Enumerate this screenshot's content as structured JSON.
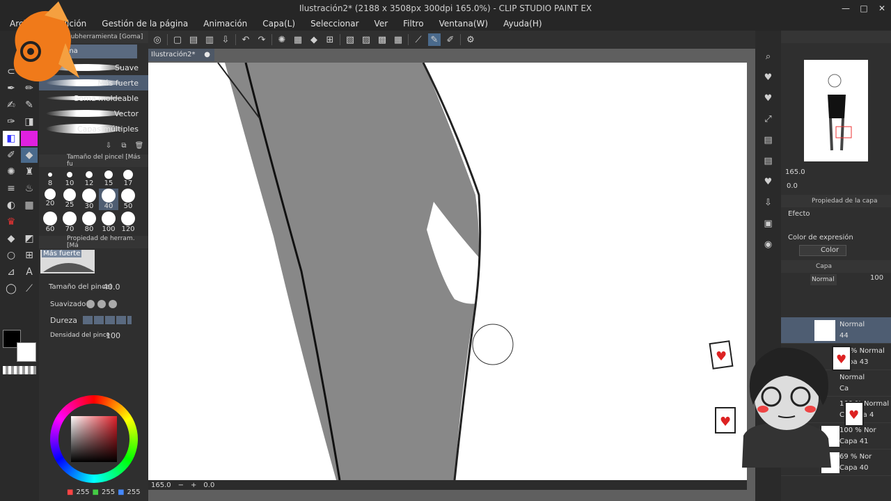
{
  "window": {
    "title": "Ilustración2* (2188 x 3508px 300dpi 165.0%) - CLIP STUDIO PAINT EX"
  },
  "menu": [
    "Archivo",
    "Edición",
    "Gestión de la página",
    "Animación",
    "Capa(L)",
    "Seleccionar",
    "Ver",
    "Filtro",
    "Ventana(W)",
    "Ayuda(H)"
  ],
  "canvas": {
    "tab": "Ilustración2*",
    "zoom": "165.0",
    "angle": "0.0"
  },
  "subtool": {
    "header": "Subherramienta [Goma]",
    "group": "Goma",
    "items": [
      "Suave",
      "Más fuerte",
      "Goma moldeable",
      "Vector",
      "Capas múltiples"
    ]
  },
  "brushsize": {
    "header": "Tamaño del pincel [Más fu",
    "values": [
      "8",
      "10",
      "12",
      "15",
      "17",
      "20",
      "25",
      "30",
      "40",
      "50",
      "60",
      "70",
      "80",
      "100",
      "120"
    ],
    "selected": "40"
  },
  "toolprop": {
    "header": "Propiedad de herram. [Má",
    "preset": "Más fuerte",
    "size_label": "Tamaño del pincel",
    "size_value": "40.0",
    "smooth_label": "Suavizado",
    "hardness_label": "Dureza",
    "density_label": "Densidad del pince",
    "density_value": "100"
  },
  "color": {
    "r": "255",
    "g": "255",
    "b": "255"
  },
  "navigator": {
    "zoom": "165.0",
    "angle": "0.0"
  },
  "layerprop": {
    "header": "Propiedad de la capa",
    "effect": "Efecto",
    "expr_label": "Color de expresión",
    "expr_value": "Color"
  },
  "layers": {
    "header": "Capa",
    "blend": "Normal",
    "opacity": "100",
    "items": [
      {
        "mode": "Normal",
        "name": "44"
      },
      {
        "mode": "50 % Normal",
        "name": "Capa 43"
      },
      {
        "mode": "Normal",
        "name": "Ca"
      },
      {
        "mode": "100 % Normal",
        "name": "Carpeta 4"
      },
      {
        "mode": "100 % Nor",
        "name": "Capa 41"
      },
      {
        "mode": "69 % Nor",
        "name": "Capa 40"
      }
    ]
  }
}
